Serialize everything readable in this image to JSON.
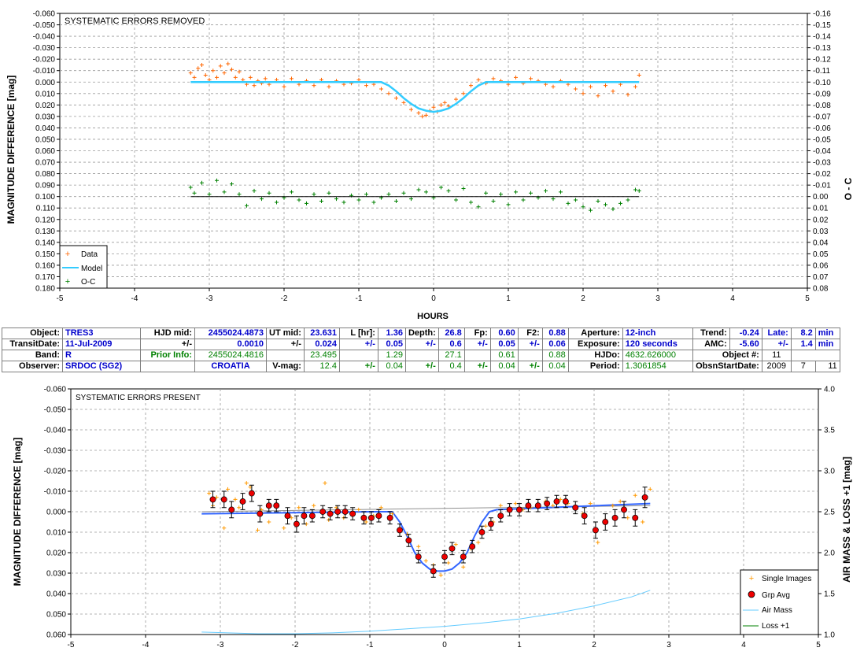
{
  "top_chart": {
    "annotation": "SYSTEMATIC ERRORS REMOVED",
    "ylabel_left": "MAGNITUDE DIFFERENCE [mag]",
    "ylabel_right": "O - C",
    "xlabel": "HOURS",
    "x_ticks": [
      "-5",
      "-4",
      "-3",
      "-2",
      "-1",
      "0",
      "1",
      "2",
      "3",
      "4",
      "5"
    ],
    "y_ticks_left": [
      "-0.060",
      "-0.050",
      "-0.040",
      "-0.030",
      "-0.020",
      "-0.010",
      "0.000",
      "0.010",
      "0.020",
      "0.030",
      "0.040",
      "0.050",
      "0.060",
      "0.070",
      "0.080",
      "0.090",
      "0.100",
      "0.110",
      "0.120",
      "0.130",
      "0.140",
      "0.150",
      "0.160",
      "0.170",
      "0.180"
    ],
    "y_ticks_right": [
      "-0.16",
      "-0.15",
      "-0.14",
      "-0.13",
      "-0.12",
      "-0.11",
      "-0.10",
      "-0.09",
      "-0.08",
      "-0.07",
      "-0.06",
      "-0.05",
      "-0.04",
      "-0.03",
      "-0.02",
      "-0.01",
      "0.00",
      "0.01",
      "0.02",
      "0.03",
      "0.04",
      "0.05",
      "0.06",
      "0.07",
      "0.08"
    ],
    "legend": [
      "Data",
      "Model",
      "O-C"
    ]
  },
  "bottom_chart": {
    "annotation": "SYSTEMATIC ERRORS PRESENT",
    "ylabel_left": "MAGNITUDE DIFFERENCE [mag]",
    "ylabel_right": "AIR MASS & LOSS +1 [mag]",
    "x_ticks": [
      "-5",
      "-4",
      "-3",
      "-2",
      "-1",
      "0",
      "1",
      "2",
      "3",
      "4",
      "5"
    ],
    "y_ticks_left": [
      "-0.060",
      "-0.050",
      "-0.040",
      "-0.030",
      "-0.020",
      "-0.010",
      "0.000",
      "0.010",
      "0.020",
      "0.030",
      "0.040",
      "0.050",
      "0.060"
    ],
    "y_ticks_right": [
      "4.0",
      "3.5",
      "3.0",
      "2.5",
      "2.0",
      "1.5",
      "1.0"
    ],
    "legend": [
      "Single Images",
      "Grp Avg",
      "Air Mass",
      "Loss +1"
    ]
  },
  "info": {
    "object_label": "Object:",
    "object": "TRES3",
    "hjd_mid_label": "HJD mid:",
    "hjd_mid": "2455024.4873",
    "ut_mid_label": "UT mid:",
    "ut_mid": "23.631",
    "l_hr_label": "L [hr]:",
    "l_hr": "1.36",
    "depth_label": "Depth:",
    "depth": "26.8",
    "fp_label": "Fp:",
    "fp": "0.60",
    "f2_label": "F2:",
    "f2": "0.88",
    "aperture_label": "Aperture:",
    "aperture": "12-inch",
    "trend_label": "Trend:",
    "trend": "-0.24",
    "late_label": "Late:",
    "late": "8.2",
    "late_unit": "min",
    "transitdate_label": "TransitDate:",
    "transitdate": "11-Jul-2009",
    "pm": "+/-",
    "hjd_err": "0.0010",
    "ut_err": "0.024",
    "l_err": "0.05",
    "depth_err": "0.6",
    "fp_err": "0.05",
    "f2_err": "0.06",
    "exposure_label": "Exposure:",
    "exposure": "120 seconds",
    "amc_label": "AMC:",
    "amc": "-5.60",
    "late_err": "1.4",
    "late_err_unit": "min",
    "band_label": "Band:",
    "band": "R",
    "prior_label": "Prior Info:",
    "prior_hjd": "2455024.4816",
    "prior_ut": "23.495",
    "prior_l": "1.29",
    "prior_depth": "27.1",
    "prior_fp": "0.61",
    "prior_f2": "0.88",
    "hjdo_label": "HJDo:",
    "hjdo": "4632.626000",
    "objnum_label": "Object #:",
    "objnum": "11",
    "observer_label": "Observer:",
    "observer": "SRDOC (SG2)",
    "location": "CROATIA",
    "vmag_label": "V-mag:",
    "vmag": "12.4",
    "vmag_err": "0.04",
    "depth_err2": "0.4",
    "fp_err2": "0.04",
    "f2_err2": "0.04",
    "period_label": "Period:",
    "period": "1.3061854",
    "obsstart_label": "ObsnStartDate:",
    "obs_year": "2009",
    "obs_month": "7",
    "obs_day": "11"
  },
  "colors": {
    "data": "#ff6600",
    "model": "#33ccff",
    "oc": "#008000",
    "grp": "#ee0000",
    "model2": "#3366ff",
    "airmass": "#66ccff",
    "loss": "#008000",
    "single": "#ff9900"
  },
  "chart_data": [
    {
      "type": "scatter",
      "title": "SYSTEMATIC ERRORS REMOVED",
      "xlabel": "HOURS",
      "ylabel": "MAGNITUDE DIFFERENCE [mag]",
      "y2label": "O - C",
      "xlim": [
        -5,
        5
      ],
      "ylim": [
        0.18,
        -0.06
      ],
      "y2lim": [
        0.08,
        -0.16
      ],
      "grid": true,
      "legend_position": "bottom-left",
      "series": [
        {
          "name": "Data",
          "kind": "points",
          "axis": "left",
          "x": [
            -3.25,
            -3.2,
            -3.15,
            -3.1,
            -3.05,
            -3.0,
            -2.95,
            -2.9,
            -2.85,
            -2.8,
            -2.75,
            -2.7,
            -2.65,
            -2.6,
            -2.55,
            -2.5,
            -2.45,
            -2.4,
            -2.35,
            -2.3,
            -2.25,
            -2.2,
            -2.1,
            -2.0,
            -1.9,
            -1.8,
            -1.7,
            -1.6,
            -1.5,
            -1.4,
            -1.3,
            -1.2,
            -1.1,
            -1.0,
            -0.9,
            -0.8,
            -0.7,
            -0.6,
            -0.5,
            -0.4,
            -0.3,
            -0.2,
            -0.15,
            -0.1,
            -0.05,
            0.0,
            0.05,
            0.1,
            0.15,
            0.2,
            0.3,
            0.4,
            0.5,
            0.6,
            0.7,
            0.8,
            0.9,
            1.0,
            1.1,
            1.2,
            1.3,
            1.4,
            1.5,
            1.6,
            1.7,
            1.8,
            1.9,
            2.0,
            2.1,
            2.2,
            2.3,
            2.4,
            2.5,
            2.6,
            2.7,
            2.75
          ],
          "y": [
            -0.008,
            -0.004,
            -0.012,
            -0.015,
            -0.006,
            -0.002,
            -0.01,
            -0.004,
            -0.014,
            -0.008,
            -0.016,
            -0.011,
            -0.004,
            -0.009,
            -0.002,
            0.002,
            -0.004,
            0.003,
            -0.001,
            0.001,
            -0.003,
            0.002,
            -0.002,
            0.004,
            -0.003,
            0.002,
            -0.001,
            0.003,
            -0.002,
            0.004,
            -0.001,
            0.002,
            0.001,
            -0.002,
            0.003,
            0.002,
            0.006,
            0.01,
            0.014,
            0.018,
            0.024,
            0.027,
            0.03,
            0.029,
            0.025,
            0.022,
            0.026,
            0.02,
            0.018,
            0.021,
            0.015,
            0.01,
            0.003,
            -0.002,
            0.001,
            -0.003,
            -0.001,
            0.002,
            -0.004,
            0.001,
            -0.003,
            -0.001,
            0.002,
            0.004,
            -0.001,
            0.002,
            0.006,
            0.01,
            0.004,
            0.012,
            0.003,
            0.008,
            0.002,
            0.011,
            0.004,
            -0.006
          ]
        },
        {
          "name": "Model",
          "kind": "line",
          "axis": "left",
          "x": [
            -3.25,
            -0.7,
            -0.6,
            -0.5,
            -0.4,
            -0.3,
            -0.2,
            -0.1,
            0.0,
            0.1,
            0.2,
            0.3,
            0.4,
            0.5,
            0.6,
            0.7,
            2.75
          ],
          "y": [
            0.0,
            0.0,
            0.003,
            0.008,
            0.014,
            0.019,
            0.023,
            0.025,
            0.026,
            0.025,
            0.023,
            0.019,
            0.014,
            0.008,
            0.003,
            0.0,
            0.0
          ]
        },
        {
          "name": "O-C",
          "kind": "points",
          "axis": "right",
          "x": [
            -3.25,
            -3.2,
            -3.1,
            -3.0,
            -2.9,
            -2.8,
            -2.7,
            -2.6,
            -2.5,
            -2.4,
            -2.3,
            -2.2,
            -2.1,
            -2.0,
            -1.9,
            -1.8,
            -1.7,
            -1.6,
            -1.5,
            -1.4,
            -1.3,
            -1.2,
            -1.1,
            -1.0,
            -0.9,
            -0.8,
            -0.7,
            -0.6,
            -0.5,
            -0.4,
            -0.3,
            -0.2,
            -0.1,
            0.0,
            0.1,
            0.2,
            0.3,
            0.4,
            0.5,
            0.6,
            0.7,
            0.8,
            0.9,
            1.0,
            1.1,
            1.2,
            1.3,
            1.4,
            1.5,
            1.6,
            1.7,
            1.8,
            1.9,
            2.0,
            2.1,
            2.2,
            2.3,
            2.4,
            2.5,
            2.6,
            2.7,
            2.75
          ],
          "y": [
            -0.008,
            -0.003,
            -0.012,
            -0.002,
            -0.014,
            -0.004,
            -0.011,
            -0.002,
            0.008,
            -0.005,
            0.002,
            -0.003,
            0.005,
            0.001,
            -0.004,
            0.003,
            0.006,
            -0.002,
            0.004,
            -0.003,
            0.002,
            0.005,
            -0.001,
            0.003,
            -0.002,
            0.005,
            0.001,
            -0.002,
            0.004,
            -0.003,
            0.002,
            -0.006,
            -0.004,
            0.001,
            -0.008,
            -0.005,
            0.003,
            -0.007,
            0.005,
            0.009,
            -0.003,
            0.004,
            -0.002,
            0.007,
            -0.004,
            0.003,
            -0.003,
            0.001,
            -0.005,
            0.002,
            -0.004,
            0.006,
            0.003,
            0.009,
            0.012,
            0.004,
            0.007,
            0.011,
            0.006,
            0.003,
            -0.006,
            -0.005
          ]
        },
        {
          "name": "O-C zero line",
          "kind": "line",
          "axis": "right",
          "x": [
            -3.25,
            2.75
          ],
          "y": [
            0.0,
            0.0
          ]
        }
      ]
    },
    {
      "type": "scatter",
      "title": "SYSTEMATIC ERRORS PRESENT",
      "xlabel": "",
      "ylabel": "MAGNITUDE DIFFERENCE [mag]",
      "y2label": "AIR MASS & LOSS +1 [mag]",
      "xlim": [
        -5,
        5
      ],
      "ylim": [
        0.06,
        -0.06
      ],
      "y2lim": [
        1.0,
        4.0
      ],
      "grid": true,
      "legend_position": "bottom-right",
      "series": [
        {
          "name": "Single Images",
          "kind": "points",
          "axis": "left",
          "x": [
            -3.15,
            -3.1,
            -3.05,
            -2.95,
            -2.9,
            -2.8,
            -2.75,
            -2.65,
            -2.6,
            -2.5,
            -2.45,
            -2.35,
            -2.25,
            -2.15,
            -2.05,
            -1.95,
            -1.85,
            -1.75,
            -1.6,
            -1.55,
            -1.45,
            -1.35,
            -1.25,
            -1.15,
            -1.05,
            -0.95,
            -0.85,
            -0.7,
            -0.6,
            -0.5,
            -0.35,
            -0.25,
            -0.15,
            -0.05,
            0.05,
            0.15,
            0.25,
            0.35,
            0.45,
            0.55,
            0.65,
            0.75,
            0.85,
            0.95,
            1.05,
            1.15,
            1.25,
            1.35,
            1.45,
            1.55,
            1.65,
            1.75,
            1.85,
            1.95,
            2.05,
            2.15,
            2.25,
            2.35,
            2.45,
            2.55,
            2.65,
            2.75
          ],
          "y": [
            -0.009,
            -0.003,
            -0.007,
            0.008,
            -0.011,
            -0.006,
            -0.002,
            -0.014,
            -0.012,
            0.009,
            -0.001,
            0.005,
            -0.004,
            0.008,
            0.003,
            -0.002,
            0.006,
            -0.003,
            -0.014,
            0.004,
            -0.002,
            0.003,
            0.001,
            -0.001,
            0.005,
            0.002,
            -0.002,
            0.001,
            0.008,
            0.011,
            0.017,
            0.024,
            0.026,
            0.031,
            0.025,
            0.016,
            0.027,
            0.018,
            0.015,
            0.007,
            0.005,
            -0.003,
            -0.001,
            -0.004,
            -0.001,
            -0.002,
            -0.003,
            -0.005,
            -0.003,
            -0.006,
            -0.004,
            -0.002,
            0.001,
            -0.004,
            0.015,
            0.004,
            -0.003,
            -0.005,
            0.003,
            -0.008,
            0.005,
            -0.011
          ]
        },
        {
          "name": "Grp Avg",
          "kind": "errorbar",
          "axis": "left",
          "x": [
            -3.1,
            -2.95,
            -2.85,
            -2.7,
            -2.58,
            -2.47,
            -2.35,
            -2.25,
            -2.1,
            -1.98,
            -1.88,
            -1.77,
            -1.63,
            -1.53,
            -1.43,
            -1.33,
            -1.23,
            -1.08,
            -0.98,
            -0.88,
            -0.73,
            -0.6,
            -0.48,
            -0.35,
            -0.15,
            0.0,
            0.1,
            0.25,
            0.37,
            0.5,
            0.62,
            0.75,
            0.87,
            1.0,
            1.12,
            1.25,
            1.37,
            1.5,
            1.62,
            1.75,
            1.87,
            2.02,
            2.15,
            2.28,
            2.4,
            2.55,
            2.68
          ],
          "y": [
            -0.006,
            -0.006,
            -0.001,
            -0.005,
            -0.009,
            0.001,
            -0.003,
            -0.003,
            0.002,
            0.006,
            0.002,
            0.002,
            0.0,
            0.001,
            0.0,
            0.0,
            0.001,
            0.003,
            0.003,
            0.002,
            0.003,
            0.009,
            0.014,
            0.022,
            0.029,
            0.022,
            0.018,
            0.022,
            0.017,
            0.01,
            0.006,
            0.002,
            -0.001,
            -0.001,
            -0.003,
            -0.003,
            -0.004,
            -0.005,
            -0.005,
            -0.002,
            0.002,
            0.009,
            0.005,
            0.003,
            -0.001,
            0.003,
            -0.007
          ],
          "err": [
            0.004,
            0.004,
            0.004,
            0.004,
            0.004,
            0.004,
            0.003,
            0.003,
            0.004,
            0.004,
            0.004,
            0.003,
            0.003,
            0.003,
            0.003,
            0.003,
            0.003,
            0.003,
            0.003,
            0.003,
            0.003,
            0.003,
            0.003,
            0.003,
            0.003,
            0.003,
            0.003,
            0.003,
            0.003,
            0.003,
            0.003,
            0.003,
            0.003,
            0.003,
            0.003,
            0.003,
            0.003,
            0.003,
            0.003,
            0.003,
            0.004,
            0.004,
            0.004,
            0.004,
            0.004,
            0.004,
            0.005
          ]
        },
        {
          "name": "Model",
          "kind": "line",
          "axis": "left",
          "x": [
            -3.25,
            -1.0,
            -0.7,
            -0.6,
            -0.5,
            -0.4,
            -0.3,
            -0.2,
            -0.1,
            0.0,
            0.1,
            0.2,
            0.3,
            0.4,
            0.5,
            0.6,
            0.7,
            2.75
          ],
          "y": [
            0.001,
            0.0,
            0.0,
            0.005,
            0.012,
            0.02,
            0.025,
            0.028,
            0.029,
            0.029,
            0.028,
            0.025,
            0.02,
            0.012,
            0.005,
            0.0,
            -0.001,
            -0.004
          ]
        },
        {
          "name": "Air Mass",
          "kind": "line",
          "axis": "right",
          "x": [
            -3.25,
            -2.5,
            -2.0,
            -1.5,
            -1.0,
            -0.5,
            0.0,
            0.5,
            1.0,
            1.5,
            2.0,
            2.5,
            2.75
          ],
          "y": [
            1.03,
            1.01,
            1.01,
            1.02,
            1.04,
            1.07,
            1.1,
            1.14,
            1.19,
            1.26,
            1.35,
            1.46,
            1.54
          ]
        },
        {
          "name": "Loss +1",
          "kind": "line",
          "axis": "left",
          "x": [
            -3.25,
            2.75
          ],
          "y": [
            0.0,
            -0.003
          ]
        }
      ]
    }
  ]
}
